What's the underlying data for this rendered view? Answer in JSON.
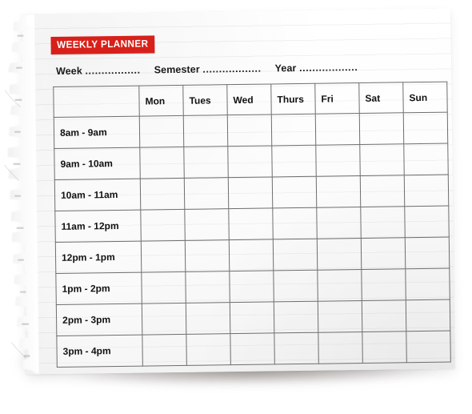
{
  "document": {
    "banner_label": "WEEKLY PLANNER",
    "accent_color": "#d8201a",
    "paper_color": "#fdfdfd",
    "grid_line_color": "#6e6e6e"
  },
  "meta": {
    "week_label": "Week",
    "week_dots": ".................",
    "semester_label": "Semester",
    "semester_dots": "..................",
    "year_label": "Year",
    "year_dots": ".................."
  },
  "table": {
    "corner_header": "",
    "day_headers": [
      "Mon",
      "Tues",
      "Wed",
      "Thurs",
      "Fri",
      "Sat",
      "Sun"
    ],
    "time_slots": [
      "8am - 9am",
      "9am - 10am",
      "10am - 11am",
      "11am - 12pm",
      "12pm - 1pm",
      "1pm - 2pm",
      "2pm - 3pm",
      "3pm - 4pm"
    ],
    "cells": [
      [
        "",
        "",
        "",
        "",
        "",
        "",
        ""
      ],
      [
        "",
        "",
        "",
        "",
        "",
        "",
        ""
      ],
      [
        "",
        "",
        "",
        "",
        "",
        "",
        ""
      ],
      [
        "",
        "",
        "",
        "",
        "",
        "",
        ""
      ],
      [
        "",
        "",
        "",
        "",
        "",
        "",
        ""
      ],
      [
        "",
        "",
        "",
        "",
        "",
        "",
        ""
      ],
      [
        "",
        "",
        "",
        "",
        "",
        "",
        ""
      ],
      [
        "",
        "",
        "",
        "",
        "",
        "",
        ""
      ]
    ]
  }
}
